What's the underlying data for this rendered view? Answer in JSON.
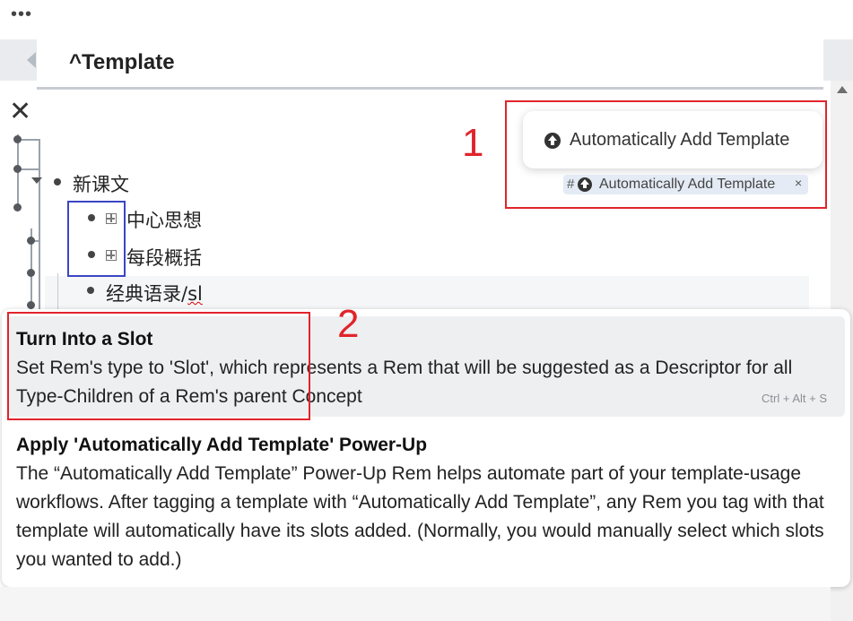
{
  "topbar": {
    "menu_glyph": "•••"
  },
  "panel": {
    "title": "^Template"
  },
  "close_glyph": "✕",
  "outline": {
    "parent": "新课文",
    "children": [
      "中心思想",
      "每段概括"
    ],
    "editing_prefix": "经典语录/",
    "editing_suffix": "sl"
  },
  "powerup_popup": {
    "label": "Automatically Add Template",
    "tag": {
      "hash": "#",
      "label": "Automatically Add Template",
      "close": "×"
    }
  },
  "annotations": {
    "num1": "1",
    "num2": "2"
  },
  "menu": {
    "items": [
      {
        "title": "Turn Into a Slot",
        "description": "Set Rem's type to 'Slot', which represents a Rem that will be suggested as a Descriptor for all Type-Children of a Rem's parent Concept",
        "shortcut": "Ctrl + Alt + S",
        "selected": true
      },
      {
        "title": "Apply 'Automatically Add Template' Power-Up",
        "description": "The “Automatically Add Template” Power-Up Rem helps automate part of your template-usage workflows. After tagging a template with “Automatically Add Template”, any Rem you tag with that template will automatically have its slots added. (Normally, you would manually select which slots you wanted to add.)",
        "shortcut": "",
        "selected": false
      }
    ]
  },
  "icons": [
    "menu-dots-icon",
    "close-icon",
    "upload-icon",
    "slot-icon",
    "collapse-caret-icon",
    "scroll-up-icon"
  ],
  "colors": {
    "annotation_red": "#e0242b",
    "annotation_blue": "#3b46c4",
    "tag_bg": "#e4ebf5",
    "menu_selected": "#eeeff1"
  }
}
